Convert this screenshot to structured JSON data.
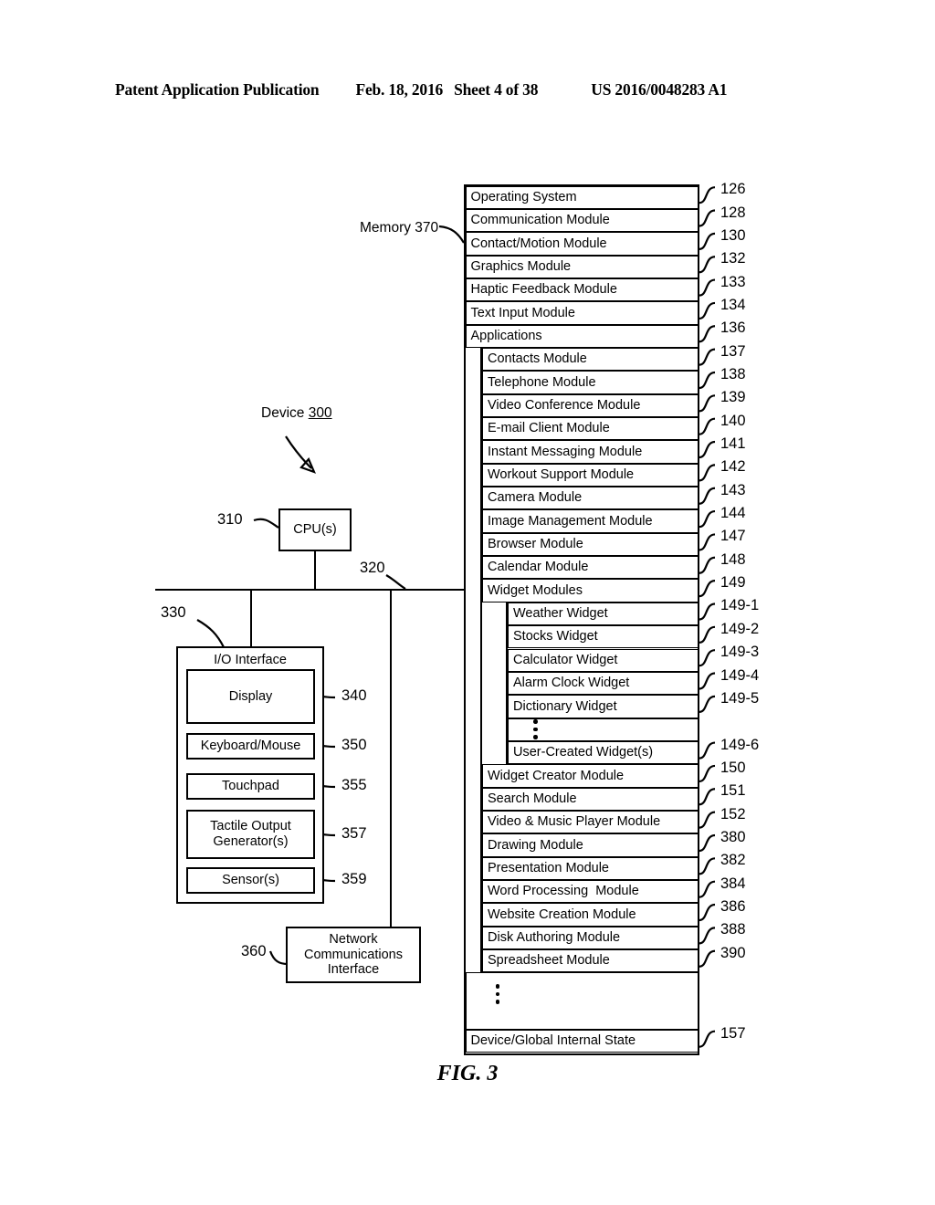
{
  "header": {
    "title": "Patent Application Publication",
    "date": "Feb. 18, 2016",
    "sheet": "Sheet 4 of 38",
    "publication_number": "US 2016/0048283 A1"
  },
  "figure": {
    "caption": "FIG. 3"
  },
  "labels": {
    "device": "Device",
    "device_ref": "300",
    "memory": "Memory 370",
    "cpu_ref": "310",
    "bus_ref": "320",
    "io_ref": "330",
    "display_ref": "340",
    "keyboard_ref": "350",
    "touchpad_ref": "355",
    "tactile_ref": "357",
    "sensor_ref": "359",
    "network_ref": "360"
  },
  "hardware": {
    "cpu": "CPU(s)",
    "io_interface": "I/O Interface",
    "io_items": [
      {
        "label": "Display",
        "ref": "340"
      },
      {
        "label": "Keyboard/Mouse",
        "ref": "350"
      },
      {
        "label": "Touchpad",
        "ref": "355"
      },
      {
        "label": "Tactile Output\nGenerator(s)",
        "ref": "357"
      },
      {
        "label": "Sensor(s)",
        "ref": "359"
      }
    ],
    "network_line1": "Network",
    "network_line2": "Communications",
    "network_line3": "Interface"
  },
  "memory": {
    "top_modules": [
      {
        "label": "Operating System",
        "ref": "126"
      },
      {
        "label": "Communication Module",
        "ref": "128"
      },
      {
        "label": "Contact/Motion Module",
        "ref": "130"
      },
      {
        "label": "Graphics Module",
        "ref": "132"
      },
      {
        "label": "Haptic Feedback Module",
        "ref": "133"
      },
      {
        "label": "Text Input Module",
        "ref": "134"
      },
      {
        "label": "Applications",
        "ref": "136"
      }
    ],
    "applications": [
      {
        "label": "Contacts Module",
        "ref": "137"
      },
      {
        "label": "Telephone Module",
        "ref": "138"
      },
      {
        "label": "Video Conference Module",
        "ref": "139"
      },
      {
        "label": "E-mail Client Module",
        "ref": "140"
      },
      {
        "label": "Instant Messaging Module",
        "ref": "141"
      },
      {
        "label": "Workout Support Module",
        "ref": "142"
      },
      {
        "label": "Camera Module",
        "ref": "143"
      },
      {
        "label": "Image Management Module",
        "ref": "144"
      },
      {
        "label": "Browser Module",
        "ref": "147"
      },
      {
        "label": "Calendar Module",
        "ref": "148"
      },
      {
        "label": "Widget Modules",
        "ref": "149"
      }
    ],
    "widgets": [
      {
        "label": "Weather Widget",
        "ref": "149-1"
      },
      {
        "label": "Stocks Widget",
        "ref": "149-2"
      },
      {
        "label": "Calculator Widget",
        "ref": "149-3"
      },
      {
        "label": "Alarm Clock Widget",
        "ref": "149-4"
      },
      {
        "label": "Dictionary Widget",
        "ref": "149-5"
      },
      {
        "label": "",
        "ref": ""
      },
      {
        "label": "User-Created Widget(s)",
        "ref": "149-6"
      }
    ],
    "applications_after_widgets": [
      {
        "label": "Widget Creator Module",
        "ref": "150"
      },
      {
        "label": "Search Module",
        "ref": "151"
      },
      {
        "label": "Video & Music Player Module",
        "ref": "152"
      },
      {
        "label": "Drawing Module",
        "ref": "380"
      },
      {
        "label": "Presentation Module",
        "ref": "382"
      },
      {
        "label": "Word Processing  Module",
        "ref": "384"
      },
      {
        "label": "Website Creation Module",
        "ref": "386"
      },
      {
        "label": "Disk Authoring Module",
        "ref": "388"
      },
      {
        "label": "Spreadsheet Module",
        "ref": "390"
      }
    ],
    "bottom": {
      "label": "Device/Global Internal State",
      "ref": "157"
    }
  }
}
